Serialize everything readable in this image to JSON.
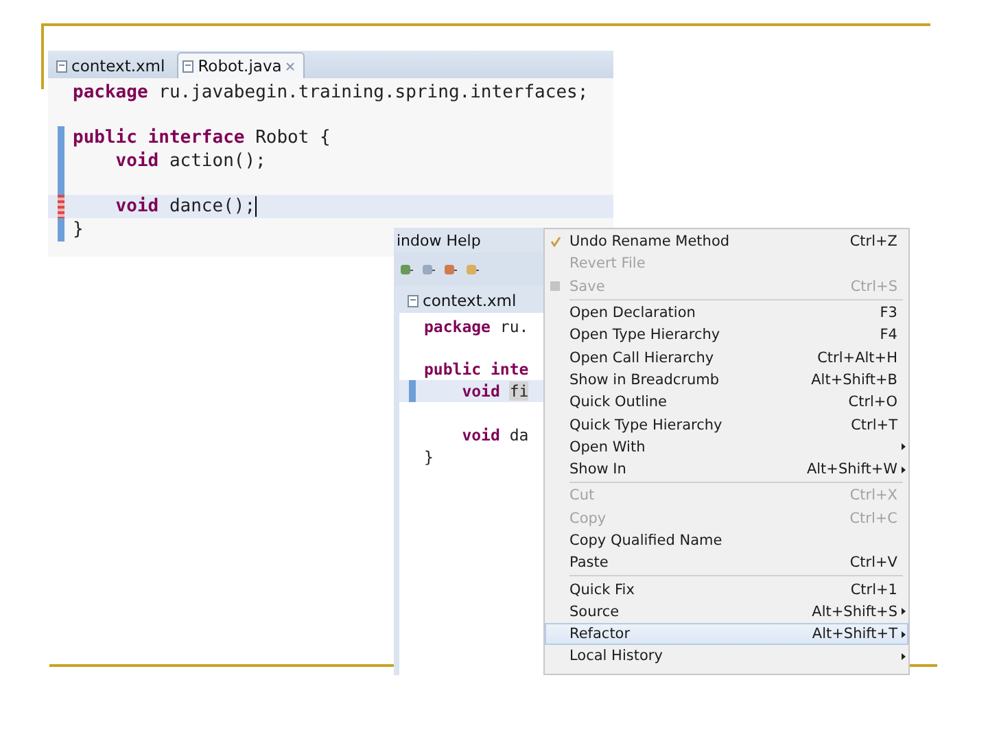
{
  "editor_main": {
    "tabs": [
      {
        "label": "context.xml",
        "selected": false,
        "closable": false
      },
      {
        "label": "Robot.java",
        "selected": true,
        "closable": true
      }
    ],
    "lines": [
      {
        "kind": "top",
        "tokens": [
          {
            "kind": "keyword",
            "text": "package"
          },
          {
            "kind": "plain",
            "text": "ru.javabegin.training.spring.interfaces;"
          }
        ],
        "highlighted": false
      },
      {
        "kind": "blank",
        "highlighted": false
      },
      {
        "kind": "top",
        "tokens": [
          {
            "kind": "keyword",
            "text": "public"
          },
          {
            "kind": "keyword",
            "text": "interface"
          },
          {
            "kind": "plain",
            "text": "Robot {"
          }
        ],
        "highlighted": false,
        "changed": true
      },
      {
        "kind": "member",
        "tokens": [
          {
            "kind": "keyword",
            "text": "void"
          },
          {
            "kind": "plain",
            "text": "action();"
          }
        ],
        "highlighted": false,
        "changed": true
      },
      {
        "kind": "blank",
        "highlighted": false,
        "changed": true
      },
      {
        "kind": "member",
        "tokens": [
          {
            "kind": "keyword",
            "text": "void"
          },
          {
            "kind": "plain",
            "text": "dance();"
          }
        ],
        "highlighted": true,
        "cursor": true,
        "error": true
      },
      {
        "kind": "top",
        "tokens": [
          {
            "kind": "plain",
            "text": "}"
          }
        ],
        "highlighted": false,
        "changed": true
      }
    ]
  },
  "editor_second": {
    "menubar": "indow Help",
    "tabs": [
      {
        "label": "context.xml",
        "selected": false
      }
    ],
    "lines": [
      {
        "kind": "top",
        "tokens": [
          {
            "kind": "keyword",
            "text": "package"
          },
          {
            "kind": "plain",
            "text": "ru."
          }
        ],
        "highlighted": false
      },
      {
        "kind": "blank",
        "highlighted": false
      },
      {
        "kind": "top",
        "tokens": [
          {
            "kind": "keyword",
            "text": "public"
          },
          {
            "kind": "keyword",
            "text": "inte"
          }
        ],
        "highlighted": false
      },
      {
        "kind": "member",
        "tokens": [
          {
            "kind": "keyword",
            "text": "void"
          },
          {
            "kind": "selection",
            "text": "fi"
          }
        ],
        "highlighted": true,
        "changed": true
      },
      {
        "kind": "blank",
        "highlighted": false
      },
      {
        "kind": "member",
        "tokens": [
          {
            "kind": "keyword",
            "text": "void"
          },
          {
            "kind": "plain",
            "text": "da"
          }
        ],
        "highlighted": false
      },
      {
        "kind": "top",
        "tokens": [
          {
            "kind": "plain",
            "text": "}"
          }
        ],
        "highlighted": false
      }
    ]
  },
  "context_menu": {
    "groups": [
      [
        {
          "label": "Undo Rename Method",
          "shortcut": "Ctrl+Z",
          "disabled": false,
          "selected": false
        },
        {
          "label": "Revert File",
          "disabled": true,
          "selected": false
        },
        {
          "label": "Save",
          "shortcut": "Ctrl+S",
          "disabled": true,
          "selected": false
        }
      ],
      [
        {
          "label": "Open Declaration",
          "shortcut": "F3",
          "disabled": false,
          "selected": false
        },
        {
          "label": "Open Type Hierarchy",
          "shortcut": "F4",
          "disabled": false,
          "selected": false
        },
        {
          "label": "Open Call Hierarchy",
          "shortcut": "Ctrl+Alt+H",
          "disabled": false,
          "selected": false
        },
        {
          "label": "Show in Breadcrumb",
          "shortcut": "Alt+Shift+B",
          "disabled": false,
          "selected": false
        },
        {
          "label": "Quick Outline",
          "shortcut": "Ctrl+O",
          "disabled": false,
          "selected": false
        },
        {
          "label": "Quick Type Hierarchy",
          "shortcut": "Ctrl+T",
          "disabled": false,
          "selected": false
        },
        {
          "label": "Open With",
          "disabled": false,
          "selected": false,
          "submenu": true
        },
        {
          "label": "Show In",
          "shortcut": "Alt+Shift+W",
          "disabled": false,
          "selected": false,
          "submenu": true
        }
      ],
      [
        {
          "label": "Cut",
          "shortcut": "Ctrl+X",
          "disabled": true,
          "selected": false
        },
        {
          "label": "Copy",
          "shortcut": "Ctrl+C",
          "disabled": true,
          "selected": false
        },
        {
          "label": "Copy Qualified Name",
          "disabled": false,
          "selected": false
        },
        {
          "label": "Paste",
          "shortcut": "Ctrl+V",
          "disabled": false,
          "selected": false
        }
      ],
      [
        {
          "label": "Quick Fix",
          "shortcut": "Ctrl+1",
          "disabled": false,
          "selected": false
        },
        {
          "label": "Source",
          "shortcut": "Alt+Shift+S",
          "disabled": false,
          "selected": false,
          "submenu": true
        },
        {
          "label": "Refactor",
          "shortcut": "Alt+Shift+T",
          "disabled": false,
          "selected": true,
          "submenu": true
        },
        {
          "label": "Local History",
          "disabled": false,
          "selected": false,
          "submenu": true
        }
      ]
    ]
  }
}
